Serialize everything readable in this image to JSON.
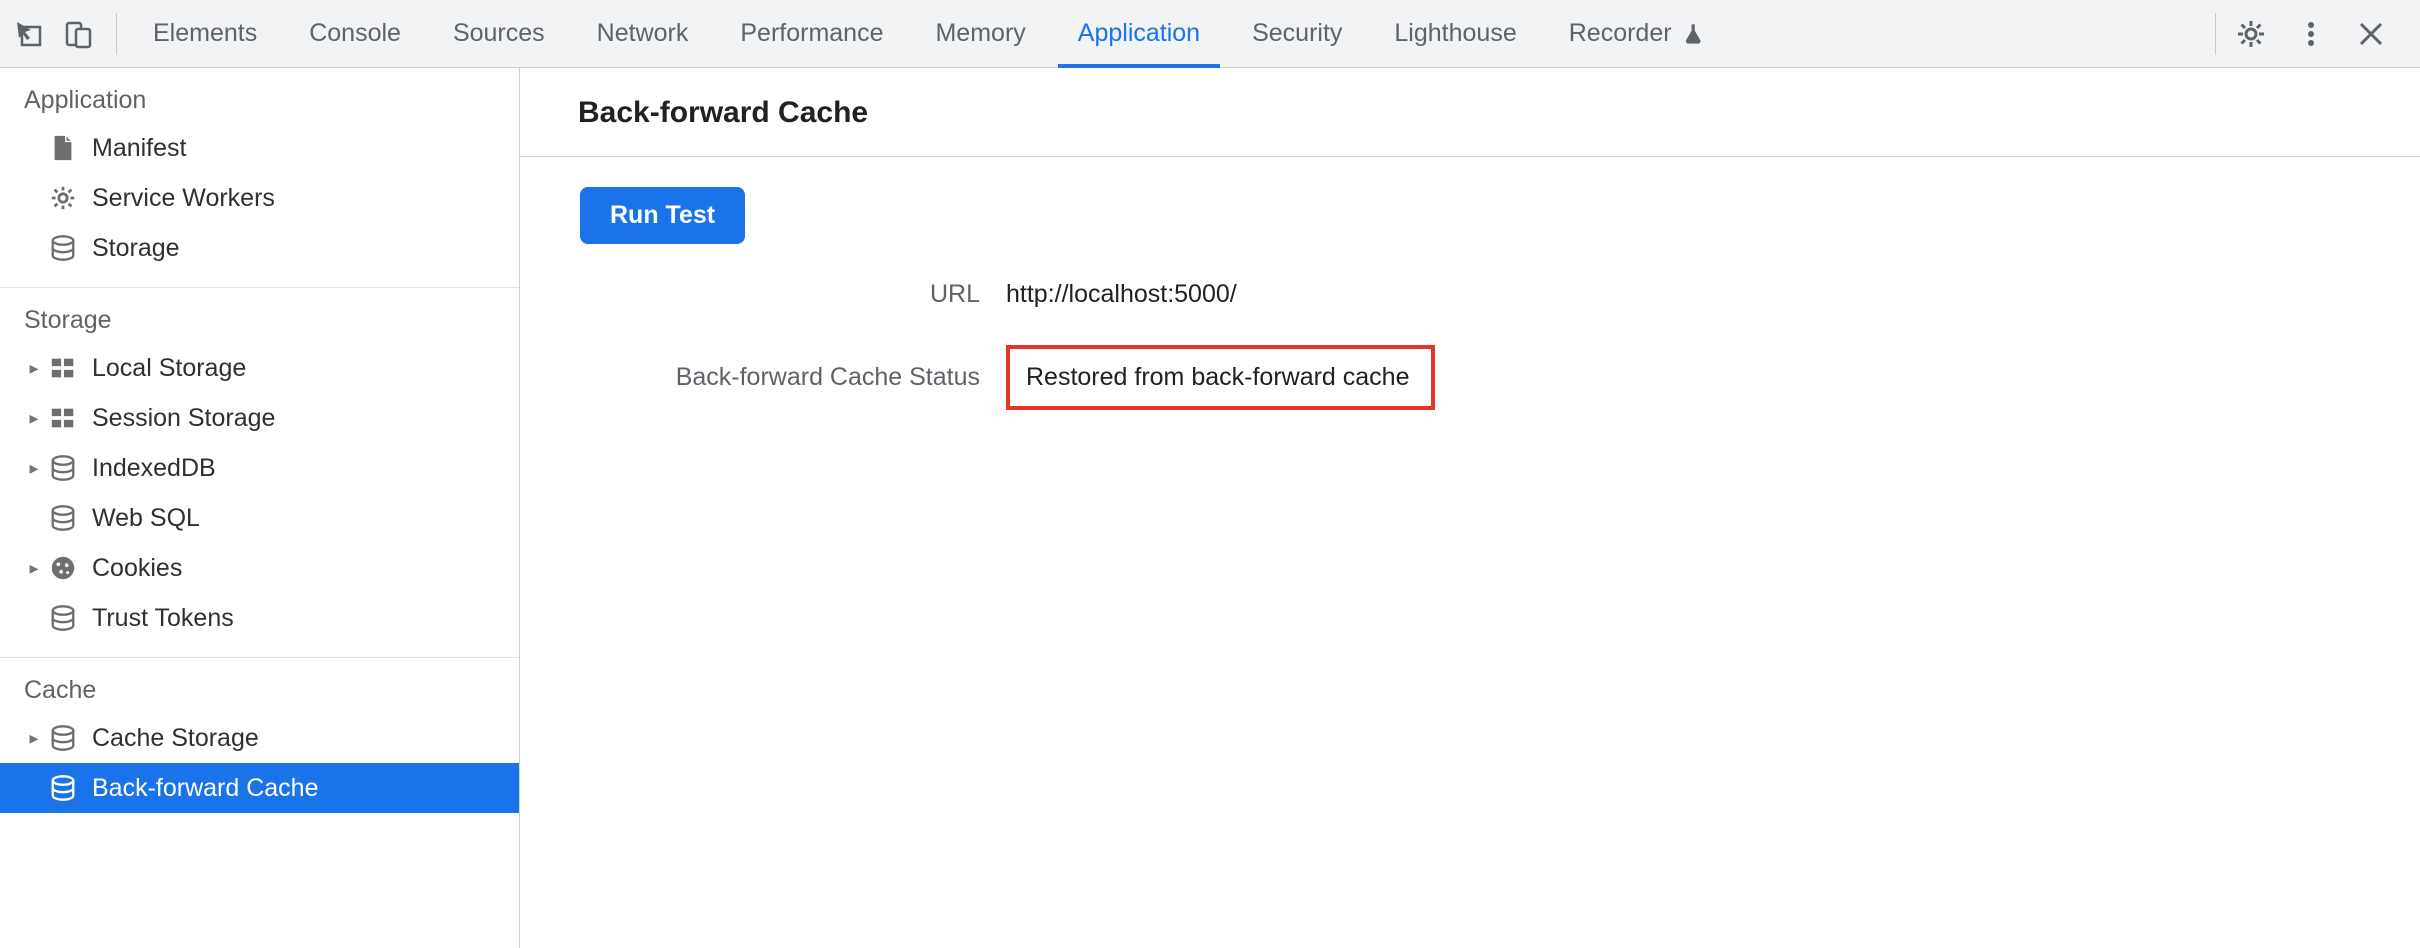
{
  "tabs": {
    "items": [
      {
        "label": "Elements"
      },
      {
        "label": "Console"
      },
      {
        "label": "Sources"
      },
      {
        "label": "Network"
      },
      {
        "label": "Performance"
      },
      {
        "label": "Memory"
      },
      {
        "label": "Application",
        "active": true
      },
      {
        "label": "Security"
      },
      {
        "label": "Lighthouse"
      },
      {
        "label": "Recorder",
        "experimental": true
      }
    ]
  },
  "sidebar": {
    "sections": [
      {
        "title": "Application",
        "items": [
          {
            "icon": "file",
            "label": "Manifest"
          },
          {
            "icon": "gear",
            "label": "Service Workers"
          },
          {
            "icon": "db",
            "label": "Storage"
          }
        ]
      },
      {
        "title": "Storage",
        "items": [
          {
            "icon": "grid",
            "label": "Local Storage",
            "expandable": true
          },
          {
            "icon": "grid",
            "label": "Session Storage",
            "expandable": true
          },
          {
            "icon": "db",
            "label": "IndexedDB",
            "expandable": true
          },
          {
            "icon": "db",
            "label": "Web SQL"
          },
          {
            "icon": "cookie",
            "label": "Cookies",
            "expandable": true
          },
          {
            "icon": "db",
            "label": "Trust Tokens"
          }
        ]
      },
      {
        "title": "Cache",
        "items": [
          {
            "icon": "db",
            "label": "Cache Storage",
            "expandable": true
          },
          {
            "icon": "db",
            "label": "Back-forward Cache",
            "selected": true
          }
        ]
      }
    ]
  },
  "content": {
    "title": "Back-forward Cache",
    "run_button": "Run Test",
    "url_label": "URL",
    "url_value": "http://localhost:5000/",
    "status_label": "Back-forward Cache Status",
    "status_value": "Restored from back-forward cache"
  }
}
